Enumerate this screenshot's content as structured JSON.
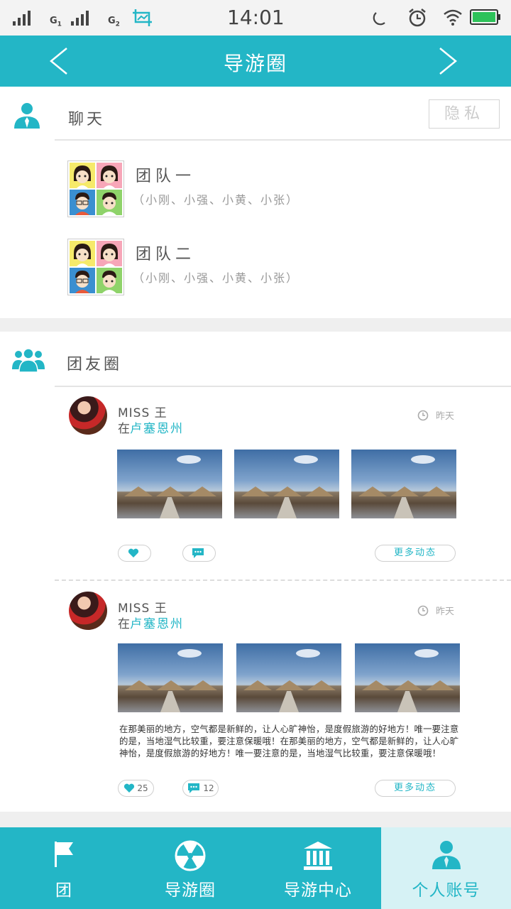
{
  "status_bar": {
    "time": "14:01",
    "sim1_label": "G",
    "sim1_sub": "1",
    "sim2_label": "G",
    "sim2_sub": "2",
    "icons": [
      "signal-icon",
      "signal-icon",
      "screenshot-icon",
      "moon-icon",
      "alarm-icon",
      "wifi-icon",
      "battery-icon"
    ]
  },
  "navbar": {
    "title": "导游圈",
    "back_icon": "chevron-left-icon",
    "forward_icon": "chevron-right-icon",
    "background": "#23b6c6"
  },
  "chat": {
    "title": "聊天",
    "privacy_button": "隐私",
    "teams": [
      {
        "name": "团队一",
        "members": "（小刚、小强、小黄、小张）"
      },
      {
        "name": "团队二",
        "members": "（小刚、小强、小黄、小张）"
      }
    ]
  },
  "moments": {
    "title": "团友圈",
    "posts": [
      {
        "user": "MISS  王",
        "loc_prefix": "在",
        "location": "卢塞恩州",
        "time": "昨天",
        "like_count": "",
        "comment_count": "",
        "text": "",
        "more_button": "更多动态"
      },
      {
        "user": "MISS  王",
        "loc_prefix": "在",
        "location": "卢塞恩州",
        "time": "昨天",
        "like_count": "25",
        "comment_count": "12",
        "text": "在那美丽的地方，空气都是新鲜的，让人心旷神怡，是度假旅游的好地方！唯一要注意的是，当地湿气比较重，要注意保暖哦！在那美丽的地方，空气都是新鲜的，让人心旷神怡，是度假旅游的好地方！唯一要注意的是，当地湿气比较重，要注意保暖哦！",
        "more_button": "更多动态"
      }
    ]
  },
  "tabbar": {
    "tabs": [
      {
        "label": "团",
        "icon": "flag-icon"
      },
      {
        "label": "导游圈",
        "icon": "radiation-icon"
      },
      {
        "label": "导游中心",
        "icon": "building-icon"
      },
      {
        "label": "个人账号",
        "icon": "person-icon",
        "active": true
      }
    ]
  }
}
